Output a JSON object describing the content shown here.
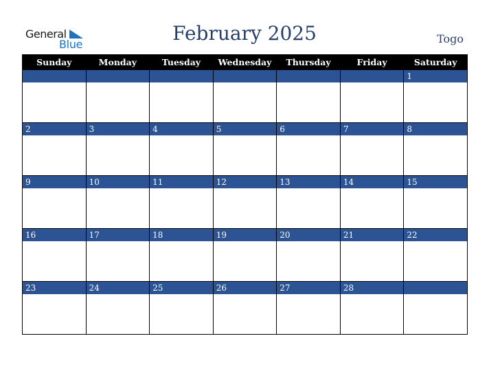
{
  "logo": {
    "word1": "General",
    "word2": "Blue"
  },
  "title": "February 2025",
  "country": "Togo",
  "weekdays": [
    "Sunday",
    "Monday",
    "Tuesday",
    "Wednesday",
    "Thursday",
    "Friday",
    "Saturday"
  ],
  "weeks": [
    [
      "",
      "",
      "",
      "",
      "",
      "",
      "1"
    ],
    [
      "2",
      "3",
      "4",
      "5",
      "6",
      "7",
      "8"
    ],
    [
      "9",
      "10",
      "11",
      "12",
      "13",
      "14",
      "15"
    ],
    [
      "16",
      "17",
      "18",
      "19",
      "20",
      "21",
      "22"
    ],
    [
      "23",
      "24",
      "25",
      "26",
      "27",
      "28",
      ""
    ]
  ],
  "colors": {
    "header_bg": "#000000",
    "day_bar": "#2c5394",
    "title": "#263f6a",
    "logo_blue": "#1e73be"
  }
}
